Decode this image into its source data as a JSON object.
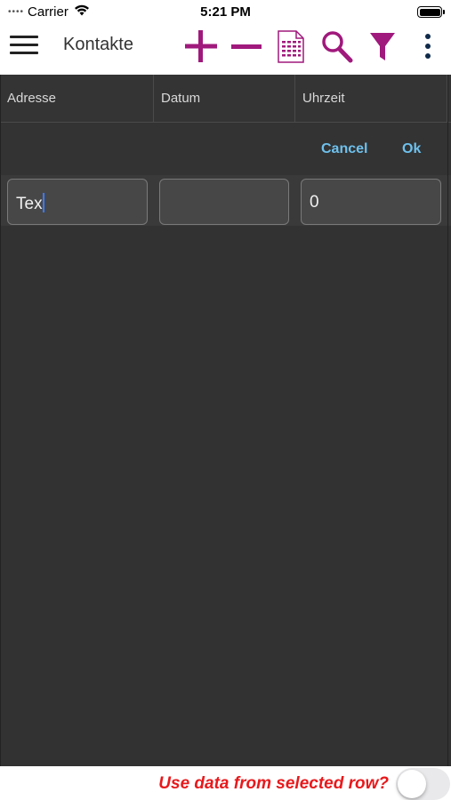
{
  "status_bar": {
    "carrier": "Carrier",
    "time": "5:21 PM"
  },
  "nav": {
    "title": "Kontakte",
    "icons": [
      "menu-icon",
      "plus-icon",
      "minus-icon",
      "list-document-icon",
      "search-icon",
      "filter-icon",
      "more-vertical-icon"
    ],
    "accent_color": "#a0197c"
  },
  "table": {
    "columns": [
      "Adresse",
      "Datum",
      "Uhrzeit"
    ],
    "actions": {
      "cancel": "Cancel",
      "ok": "Ok"
    },
    "inputs": {
      "adresse": "Tex",
      "datum": "",
      "uhrzeit": "0"
    }
  },
  "bottom": {
    "label": "Use data from selected row?",
    "toggle_on": false,
    "label_color": "#e8191c"
  }
}
